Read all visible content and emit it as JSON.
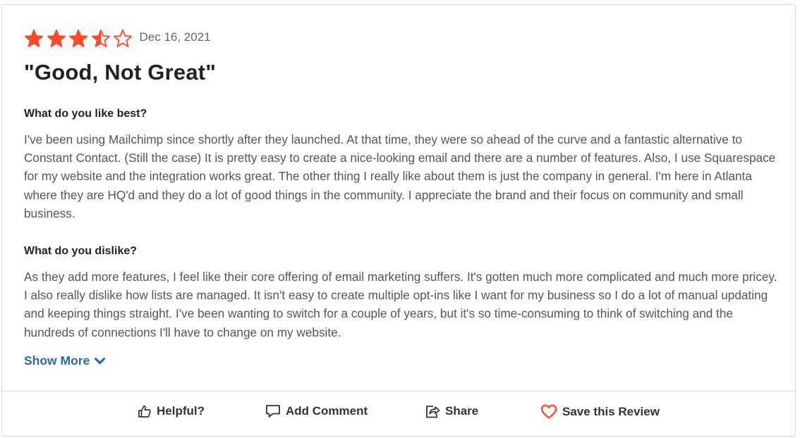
{
  "review": {
    "rating": 3.5,
    "rating_max": 5,
    "star_color": "#ff492c",
    "date": "Dec 16, 2021",
    "title": "\"Good, Not Great\"",
    "sections": [
      {
        "question": "What do you like best?",
        "answer": "I've been using Mailchimp since shortly after they launched. At that time, they were so ahead of the curve and a fantastic alternative to Constant Contact. (Still the case) It is pretty easy to create a nice-looking email and there are a number of features. Also, I use Squarespace for my website and the integration works great. The other thing I really like about them is just the company in general. I'm here in Atlanta where they are HQ'd and they do a lot of good things in the community. I appreciate the brand and their focus on community and small business."
      },
      {
        "question": "What do you dislike?",
        "answer": "As they add more features, I feel like their core offering of email marketing suffers. It's gotten much more complicated and much more pricey. I also really dislike how lists are managed. It isn't easy to create multiple opt-ins like I want for my business so I do a lot of manual updating and keeping things straight. I've been wanting to switch for a couple of years, but it's so time-consuming to think of switching and the hundreds of connections I'll have to change on my website."
      }
    ],
    "show_more_label": "Show More",
    "link_color": "#2c6c96"
  },
  "actions": {
    "helpful": {
      "label": "Helpful?",
      "icon": "thumbs-up-icon"
    },
    "comment": {
      "label": "Add Comment",
      "icon": "comment-icon"
    },
    "share": {
      "label": "Share",
      "icon": "share-icon"
    },
    "save": {
      "label": "Save this Review",
      "icon": "heart-icon",
      "icon_color": "#ff492c"
    }
  }
}
